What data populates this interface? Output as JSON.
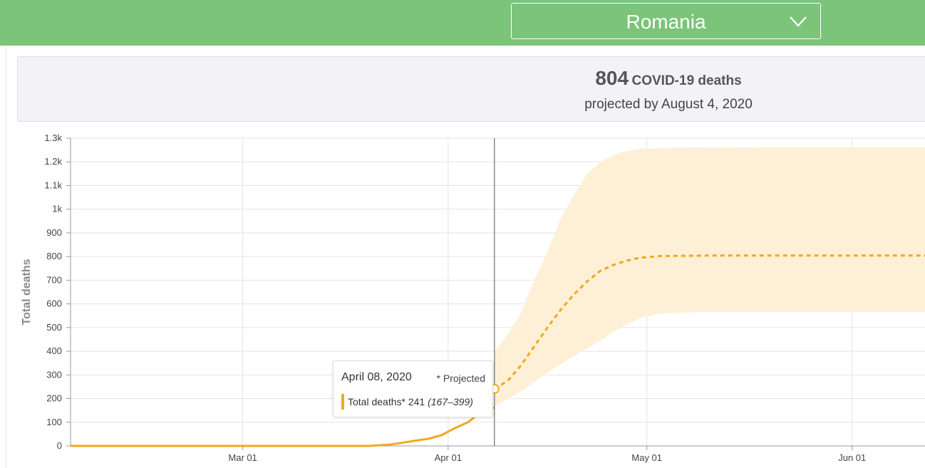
{
  "header": {
    "country_select": {
      "selected": "Romania"
    }
  },
  "summary": {
    "count": "804",
    "unit": "COVID-19 deaths",
    "subtitle": "projected by August 4, 2020"
  },
  "tooltip": {
    "date": "April 08, 2020",
    "projected_note": "* Projected",
    "series_label": "Total deaths*",
    "value": "241",
    "range": "(167–399)"
  },
  "colors": {
    "header_bg": "#7bc47a",
    "series": "#f2a81d",
    "band": "#fdf0d6",
    "grid": "#e3e3e3"
  },
  "chart_data": {
    "type": "line",
    "ylabel": "Total deaths",
    "ylim": [
      0,
      1300
    ],
    "yticks": [
      0,
      100,
      200,
      300,
      400,
      500,
      600,
      700,
      800,
      900,
      1000,
      1100,
      1200,
      1300
    ],
    "ytick_labels": [
      "0",
      "100",
      "200",
      "300",
      "400",
      "500",
      "600",
      "700",
      "800",
      "900",
      "1k",
      "1.1k",
      "1.2k",
      "1.3k"
    ],
    "xlim": [
      "2020-02-04",
      "2020-06-12"
    ],
    "xticks": [
      "2020-03-01",
      "2020-04-01",
      "2020-05-01",
      "2020-06-01"
    ],
    "xtick_labels": [
      "Mar 01",
      "Apr 01",
      "May 01",
      "Jun 01"
    ],
    "cursor_date": "2020-04-08",
    "actual": [
      [
        "2020-02-04",
        0
      ],
      [
        "2020-03-20",
        0
      ],
      [
        "2020-03-23",
        5
      ],
      [
        "2020-03-25",
        13
      ],
      [
        "2020-03-27",
        22
      ],
      [
        "2020-03-29",
        30
      ],
      [
        "2020-03-31",
        45
      ],
      [
        "2020-04-02",
        75
      ],
      [
        "2020-04-04",
        100
      ],
      [
        "2020-04-06",
        145
      ],
      [
        "2020-04-08",
        162
      ]
    ],
    "projected": [
      [
        "2020-04-08",
        241
      ],
      [
        "2020-04-10",
        275
      ],
      [
        "2020-04-12",
        340
      ],
      [
        "2020-04-14",
        420
      ],
      [
        "2020-04-16",
        500
      ],
      [
        "2020-04-18",
        575
      ],
      [
        "2020-04-20",
        640
      ],
      [
        "2020-04-22",
        695
      ],
      [
        "2020-04-24",
        740
      ],
      [
        "2020-04-26",
        765
      ],
      [
        "2020-04-28",
        783
      ],
      [
        "2020-04-30",
        795
      ],
      [
        "2020-05-03",
        802
      ],
      [
        "2020-05-10",
        804
      ],
      [
        "2020-06-12",
        804
      ]
    ],
    "projected_lower": [
      [
        "2020-04-08",
        167
      ],
      [
        "2020-04-12",
        230
      ],
      [
        "2020-04-16",
        310
      ],
      [
        "2020-04-20",
        380
      ],
      [
        "2020-04-24",
        445
      ],
      [
        "2020-04-27",
        500
      ],
      [
        "2020-04-30",
        540
      ],
      [
        "2020-05-03",
        560
      ],
      [
        "2020-05-10",
        566
      ],
      [
        "2020-06-12",
        566
      ]
    ],
    "projected_upper": [
      [
        "2020-04-08",
        399
      ],
      [
        "2020-04-10",
        470
      ],
      [
        "2020-04-12",
        560
      ],
      [
        "2020-04-14",
        700
      ],
      [
        "2020-04-16",
        820
      ],
      [
        "2020-04-18",
        960
      ],
      [
        "2020-04-20",
        1060
      ],
      [
        "2020-04-22",
        1150
      ],
      [
        "2020-04-24",
        1200
      ],
      [
        "2020-04-27",
        1240
      ],
      [
        "2020-04-30",
        1255
      ],
      [
        "2020-05-05",
        1260
      ],
      [
        "2020-06-12",
        1262
      ]
    ]
  }
}
